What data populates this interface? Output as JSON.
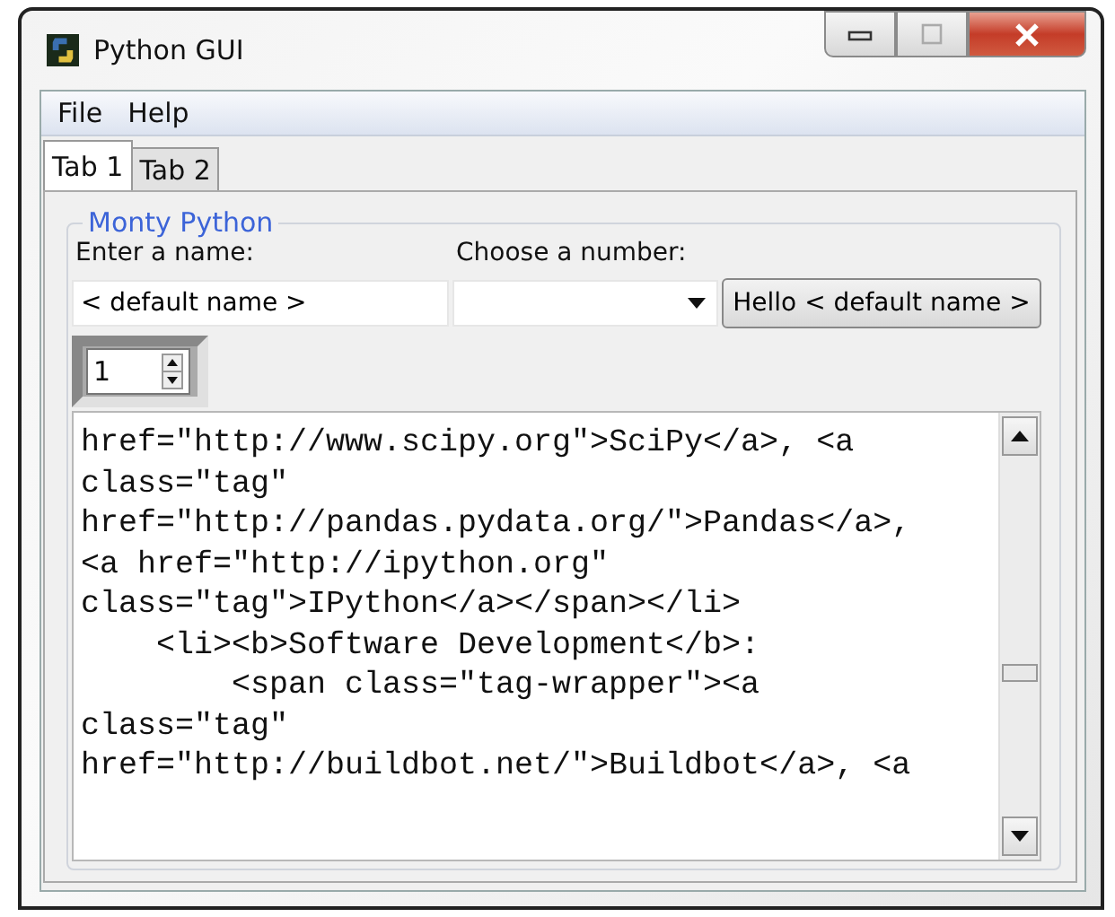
{
  "window": {
    "title": "Python GUI"
  },
  "menu": [
    "File",
    "Help"
  ],
  "tabs": [
    {
      "label": "Tab 1",
      "selected": true
    },
    {
      "label": "Tab 2",
      "selected": false
    }
  ],
  "group": {
    "title": "Monty Python",
    "name_label": "Enter a name:",
    "number_label": "Choose a number:",
    "name_value": "< default name >",
    "button": "Hello < default name >",
    "spinbox_value": "1"
  },
  "text_area": {
    "lines": [
      "href=\"http://www.scipy.org\">SciPy</a>, <a",
      "class=\"tag\"",
      "href=\"http://pandas.pydata.org/\">Pandas</a>,",
      "<a href=\"http://ipython.org\"",
      "class=\"tag\">IPython</a></span></li>",
      "    <li><b>Software Development</b>:",
      "        <span class=\"tag-wrapper\"><a",
      "class=\"tag\"",
      "href=\"http://buildbot.net/\">Buildbot</a>, <a"
    ]
  }
}
